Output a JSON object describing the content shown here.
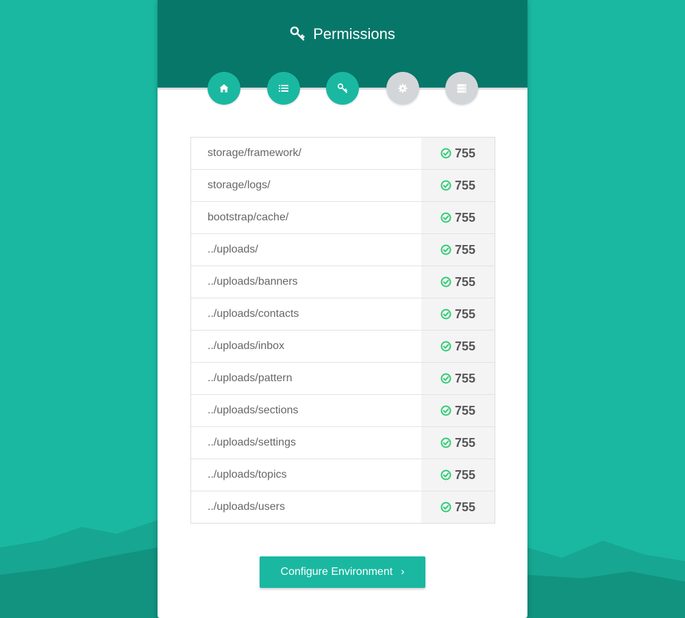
{
  "title": "Permissions",
  "steps": [
    {
      "icon": "home-icon",
      "state": "complete"
    },
    {
      "icon": "list-icon",
      "state": "complete"
    },
    {
      "icon": "key-icon",
      "state": "current"
    },
    {
      "icon": "gear-icon",
      "state": "pending"
    },
    {
      "icon": "server-icon",
      "state": "pending"
    }
  ],
  "permissions": [
    {
      "path": "storage/framework/",
      "value": "755"
    },
    {
      "path": "storage/logs/",
      "value": "755"
    },
    {
      "path": "bootstrap/cache/",
      "value": "755"
    },
    {
      "path": "../uploads/",
      "value": "755"
    },
    {
      "path": "../uploads/banners",
      "value": "755"
    },
    {
      "path": "../uploads/contacts",
      "value": "755"
    },
    {
      "path": "../uploads/inbox",
      "value": "755"
    },
    {
      "path": "../uploads/pattern",
      "value": "755"
    },
    {
      "path": "../uploads/sections",
      "value": "755"
    },
    {
      "path": "../uploads/settings",
      "value": "755"
    },
    {
      "path": "../uploads/topics",
      "value": "755"
    },
    {
      "path": "../uploads/users",
      "value": "755"
    }
  ],
  "button": {
    "label": "Configure Environment",
    "chevron": "›"
  },
  "colors": {
    "background": "#1ab8a1",
    "header": "#07776a",
    "accent": "#1ab8a1",
    "inactive": "#d3d6d8",
    "check": "#2ecc71"
  }
}
